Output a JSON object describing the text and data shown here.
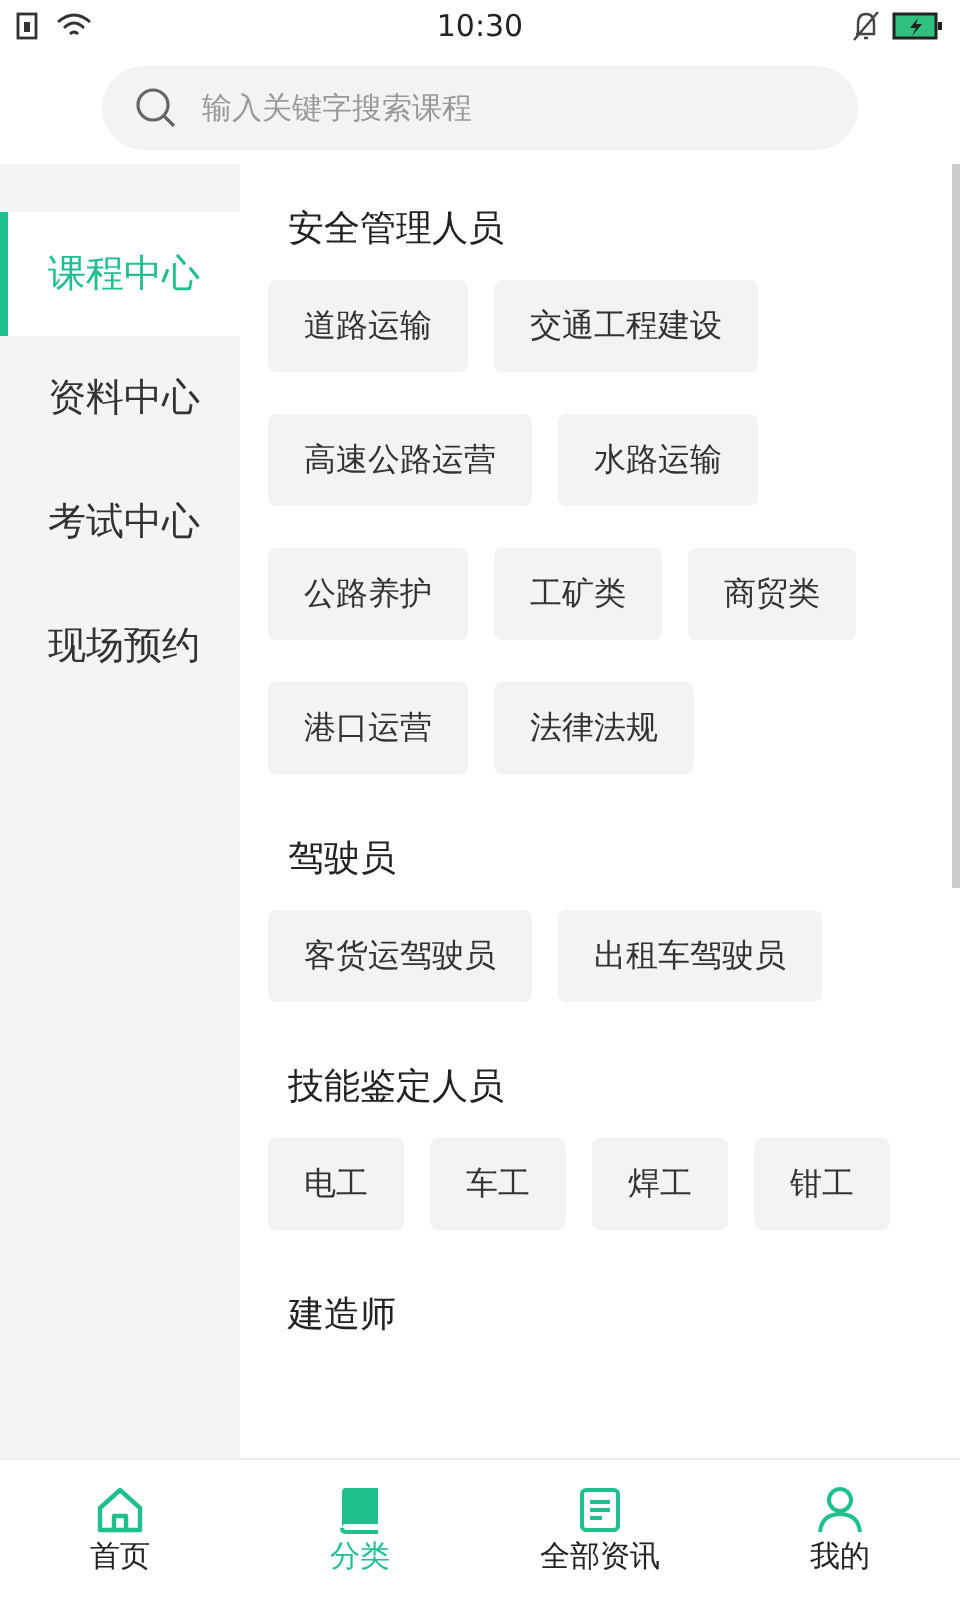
{
  "status_bar": {
    "time": "10:30"
  },
  "search": {
    "placeholder": "输入关键字搜索课程"
  },
  "sidebar": {
    "items": [
      {
        "label": "课程中心",
        "selected": true
      },
      {
        "label": "资料中心",
        "selected": false
      },
      {
        "label": "考试中心",
        "selected": false
      },
      {
        "label": "现场预约",
        "selected": false
      }
    ]
  },
  "sections": [
    {
      "title": "安全管理人员",
      "tags": [
        "道路运输",
        "交通工程建设",
        "高速公路运营",
        "水路运输",
        "公路养护",
        "工矿类",
        "商贸类",
        "港口运营",
        "法律法规"
      ]
    },
    {
      "title": "驾驶员",
      "tags": [
        "客货运驾驶员",
        "出租车驾驶员"
      ]
    },
    {
      "title": "技能鉴定人员",
      "tags": [
        "电工",
        "车工",
        "焊工",
        "钳工"
      ]
    },
    {
      "title": "建造师"
    }
  ],
  "tab_bar": [
    {
      "label": "首页",
      "kind": "home",
      "selected": false
    },
    {
      "label": "分类",
      "kind": "book",
      "selected": true
    },
    {
      "label": "全部资讯",
      "kind": "news",
      "selected": false
    },
    {
      "label": "我的",
      "kind": "person",
      "selected": false
    }
  ]
}
